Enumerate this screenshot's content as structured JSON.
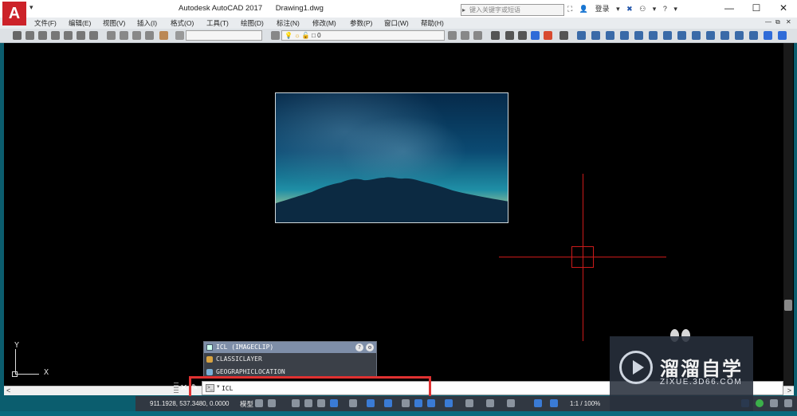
{
  "titlebar": {
    "app_logo": "A",
    "app_name": "Autodesk AutoCAD 2017",
    "document": "Drawing1.dwg",
    "search_placeholder": "键入关键字或短语",
    "signin_label": "登录",
    "help_label": "?",
    "minimize": "—",
    "maximize": "☐",
    "close": "✕"
  },
  "menubar": {
    "items": [
      "文件(F)",
      "编辑(E)",
      "视图(V)",
      "插入(I)",
      "格式(O)",
      "工具(T)",
      "绘图(D)",
      "标注(N)",
      "修改(M)",
      "参数(P)",
      "窗口(W)",
      "帮助(H)"
    ],
    "controls": [
      "—",
      "⧉",
      "✕"
    ]
  },
  "toolbar": {
    "layer_value": "0"
  },
  "canvas": {
    "ucs_x": "X",
    "ucs_y": "Y"
  },
  "autocomplete": {
    "header": "ICL (IMAGECLIP)",
    "items": [
      "CLASSICLAYER",
      "GEOGRAPHICLOCATION"
    ],
    "help_icon": "?",
    "settings_icon": "⚙"
  },
  "commandline": {
    "close": "✕",
    "wrench": "🔧",
    "prompt_icon": ">_",
    "arrow": "▾",
    "input_value": "ICL"
  },
  "statusbar": {
    "coordinates": "911.1928, 537.3480, 0.0000",
    "mode": "模型",
    "scale": "1:1 / 100%"
  },
  "watermark": {
    "title": "溜溜自学",
    "subtitle": "ZIXUE.3D66.COM"
  },
  "colors": {
    "crosshair": "#cc1a1a",
    "highlight": "#e03131",
    "canvas": "#000000",
    "statusbar": "#313842"
  }
}
